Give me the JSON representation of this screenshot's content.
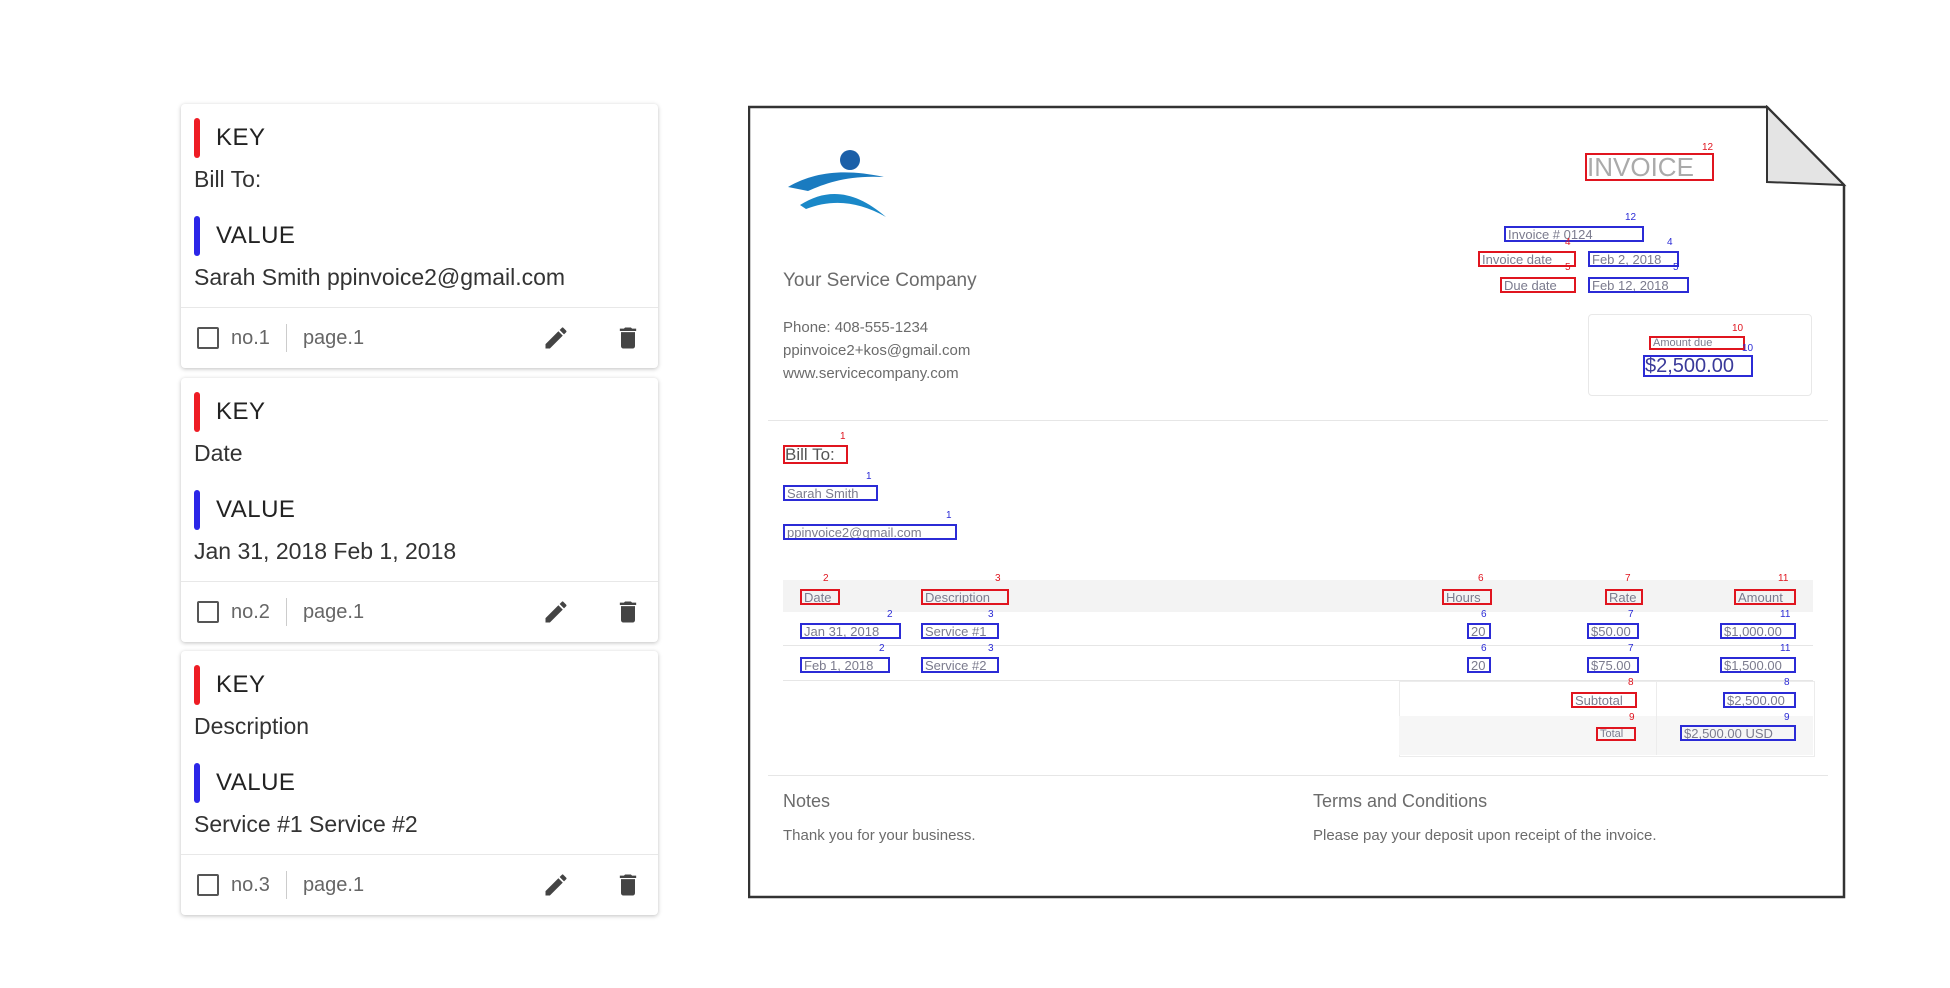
{
  "cards": [
    {
      "key_label": "KEY",
      "key_text": "Bill To:",
      "value_label": "VALUE",
      "value_text": "Sarah Smith ppinvoice2@gmail.com",
      "no": "no.1",
      "page": "page.1"
    },
    {
      "key_label": "KEY",
      "key_text": "Date",
      "value_label": "VALUE",
      "value_text": "Jan 31, 2018 Feb 1, 2018",
      "no": "no.2",
      "page": "page.1"
    },
    {
      "key_label": "KEY",
      "key_text": "Description",
      "value_label": "VALUE",
      "value_text": "Service #1 Service #2",
      "no": "no.3",
      "page": "page.1"
    }
  ],
  "invoice": {
    "company_name": "Your Service Company",
    "phone": "Phone: 408-555-1234",
    "email": "ppinvoice2+kos@gmail.com",
    "website": "www.servicecompany.com",
    "title": "INVOICE",
    "invoice_no_label": "Invoice #",
    "invoice_no_value": "0124",
    "invoice_date_label": "Invoice date",
    "invoice_date_value": "Feb 2, 2018",
    "due_date_label": "Due date",
    "due_date_value": "Feb 12, 2018",
    "amount_due_label": "Amount due",
    "amount_due_value": "$2,500.00",
    "bill_to_label": "Bill To:",
    "bill_to_name": "Sarah Smith",
    "bill_to_email": "ppinvoice2@gmail.com",
    "table_headers": {
      "date": "Date",
      "description": "Description",
      "hours": "Hours",
      "rate": "Rate",
      "amount": "Amount"
    },
    "rows": [
      {
        "date": "Jan 31, 2018",
        "description": "Service #1",
        "hours": "20",
        "rate": "$50.00",
        "amount": "$1,000.00"
      },
      {
        "date": "Feb 1, 2018",
        "description": "Service #2",
        "hours": "20",
        "rate": "$75.00",
        "amount": "$1,500.00"
      }
    ],
    "subtotal_label": "Subtotal",
    "subtotal_value": "$2,500.00",
    "total_label": "Total",
    "total_value": "$2,500.00 USD",
    "notes_title": "Notes",
    "notes_text": "Thank you for your business.",
    "terms_title": "Terms and Conditions",
    "terms_text": "Please pay your deposit upon receipt of the invoice.",
    "markers": {
      "title": "12",
      "invoice_no": "12",
      "invoice_date": "4",
      "due_date": "5",
      "amount_due_label": "10",
      "amount_due_value": "10",
      "bill_to": "1",
      "date": "2",
      "description": "3",
      "hours": "6",
      "rate": "7",
      "amount": "11",
      "subtotal": "8",
      "total": "9"
    }
  },
  "colors": {
    "key": "#ee1c24",
    "value": "#2b26e8"
  }
}
